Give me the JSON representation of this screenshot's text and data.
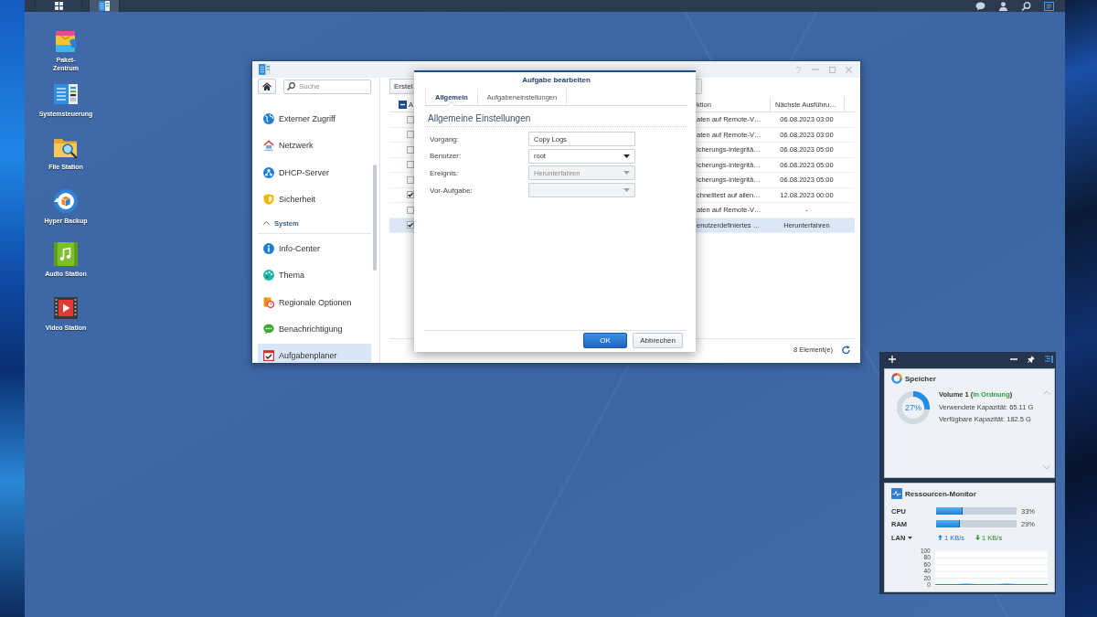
{
  "taskbar": {
    "apps": [
      {
        "kind": "menu",
        "selected": false
      },
      {
        "kind": "panel",
        "selected": true
      }
    ],
    "tray": [
      {
        "kind": "chat",
        "selected": false
      },
      {
        "kind": "user",
        "selected": false
      },
      {
        "kind": "search",
        "selected": false
      },
      {
        "kind": "widgets",
        "selected": true
      }
    ]
  },
  "desktop": {
    "shortcuts": [
      {
        "kind": "package",
        "label": "Paket-\nZentrum"
      },
      {
        "kind": "panel",
        "label": "Systemsteuerung"
      },
      {
        "kind": "folder",
        "label": "File Station"
      },
      {
        "kind": "backup",
        "label": "Hyper Backup"
      },
      {
        "kind": "audio",
        "label": "Audio Station"
      },
      {
        "kind": "video",
        "label": "Video Station"
      }
    ]
  },
  "control_panel": {
    "search": {
      "placeholder": "Suche"
    },
    "sidebar": {
      "sections": [
        {
          "items": [
            {
              "kind": "globe",
              "label": "Externer Zugriff",
              "selected": false
            },
            {
              "kind": "house",
              "label": "Netzwerk",
              "selected": false
            },
            {
              "kind": "network",
              "label": "DHCP-Server",
              "selected": false
            },
            {
              "kind": "shield",
              "label": "Sicherheit",
              "selected": false
            }
          ]
        },
        {
          "label": "System",
          "expanded": true,
          "items": [
            {
              "kind": "info",
              "label": "Info-Center",
              "selected": false
            },
            {
              "kind": "palette",
              "label": "Thema",
              "selected": false
            },
            {
              "kind": "regional",
              "label": "Regionale Optionen",
              "selected": false
            },
            {
              "kind": "chat",
              "label": "Benachrichtigung",
              "selected": false
            },
            {
              "kind": "calendar",
              "label": "Aufgabenplaner",
              "selected": true
            }
          ]
        }
      ]
    },
    "toolbar": {
      "buttons": [
        "Erstel"
      ]
    },
    "table": {
      "select_all": {
        "indeterminate": true
      },
      "columns": [
        "A",
        "ktion",
        "Nächste Ausführu…"
      ],
      "rows": [
        {
          "checked": false,
          "action": "aten auf Remote-V…",
          "next_run": "06.08.2023 03:00",
          "selected": false
        },
        {
          "checked": false,
          "action": "aten auf Remote-V…",
          "next_run": "06.08.2023 03:00",
          "selected": false
        },
        {
          "checked": false,
          "action": "icherungs-Integritä…",
          "next_run": "06.08.2023 05:00",
          "selected": false
        },
        {
          "checked": false,
          "action": "icherungs-Integritä…",
          "next_run": "06.08.2023 05:00",
          "selected": false
        },
        {
          "checked": false,
          "action": "icherungs-Integritä…",
          "next_run": "06.08.2023 05:00",
          "selected": false
        },
        {
          "checked": true,
          "action": "chnelltest auf allen…",
          "next_run": "12.08.2023 00:00",
          "selected": false
        },
        {
          "checked": false,
          "action": "aten auf Remote-V…",
          "next_run": "-",
          "selected": false
        },
        {
          "checked": true,
          "action": "enutzerdefiniertes …",
          "next_run": "Herunterfahren",
          "selected": true
        }
      ]
    },
    "footer": {
      "count": "8 Element(e)"
    }
  },
  "dialog": {
    "title": "Aufgabe bearbeiten",
    "tabs": [
      {
        "label": "Allgemein",
        "selected": true
      },
      {
        "label": "Aufgabeneinstellungen",
        "selected": false
      }
    ],
    "section_title": "Allgemeine Einstellungen",
    "fields": [
      {
        "label": "Vorgang:",
        "kind": "text",
        "value": "Copy Logs",
        "disabled": false
      },
      {
        "label": "Benutzer:",
        "kind": "select",
        "value": "root",
        "disabled": false
      },
      {
        "label": "Ereignis:",
        "kind": "select",
        "value": "Herunterfahren",
        "disabled": true
      },
      {
        "label": "Vor-Aufgabe:",
        "kind": "select",
        "disabled": true
      }
    ],
    "buttons": [
      {
        "label": "OK",
        "primary": true
      },
      {
        "label": "Abbrechen",
        "primary": false
      }
    ]
  },
  "widgets": {
    "storage": {
      "title": "Speicher",
      "level": 0.27,
      "percent": "27%",
      "volume": "Volume 1 (**In Ordnung**)",
      "healthy": true,
      "lines": [
        "Verwendete Kapazität: 65.11 G",
        "Verfügbare Kapazität: 182.5 G"
      ]
    },
    "resource_monitor": {
      "title": "Ressourcen-Monitor",
      "meters": [
        {
          "label": "CPU",
          "level": 0.33,
          "reading": "33%"
        },
        {
          "label": "RAM",
          "level": 0.29,
          "reading": "29%"
        }
      ],
      "network": {
        "interface": "LAN",
        "upload": "1 KB/s",
        "download": "1 KB/s",
        "chart_data": {
          "type": "line",
          "ylim": [
            0,
            100
          ],
          "yticks": [
            0,
            20,
            40,
            60,
            80,
            100
          ],
          "grid": true,
          "series": [
            {
              "color": "#1f8fc0",
              "values": [
                1,
                1,
                1,
                2,
                1,
                1,
                1,
                2,
                1,
                1,
                1,
                1
              ]
            }
          ]
        }
      }
    }
  }
}
